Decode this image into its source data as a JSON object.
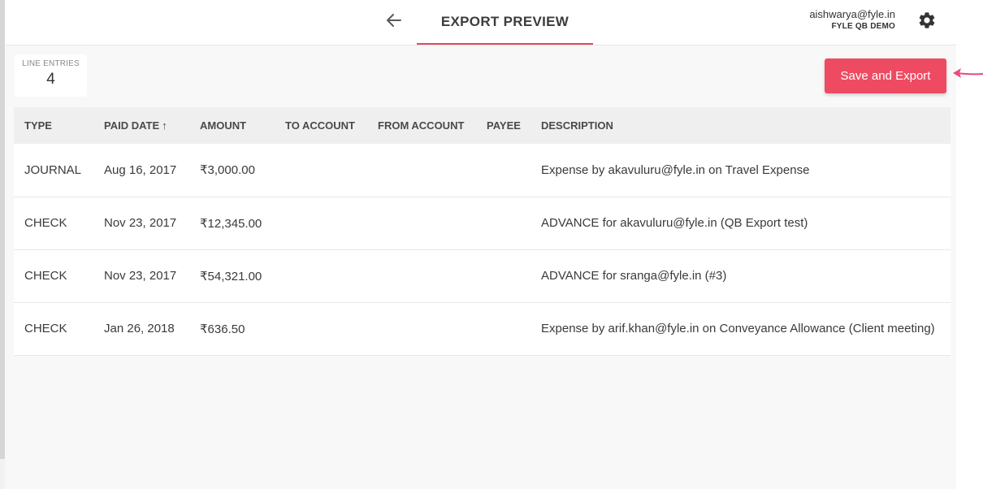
{
  "header": {
    "title": "EXPORT PREVIEW",
    "user_email": "aishwarya@fyle.in",
    "org_name": "FYLE QB DEMO"
  },
  "summary": {
    "label": "LINE ENTRIES",
    "count": "4"
  },
  "actions": {
    "save_export_label": "Save and Export"
  },
  "table": {
    "columns": {
      "type": "TYPE",
      "paid_date": "PAID DATE",
      "paid_date_sort": "↑",
      "amount": "AMOUNT",
      "to_account": "TO ACCOUNT",
      "from_account": "FROM ACCOUNT",
      "payee": "PAYEE",
      "description": "DESCRIPTION"
    },
    "rows": [
      {
        "type": "JOURNAL",
        "paid_date": "Aug 16, 2017",
        "amount": "₹3,000.00",
        "to_account": "",
        "from_account": "",
        "payee": "",
        "description": "Expense by akavuluru@fyle.in on Travel Expense"
      },
      {
        "type": "CHECK",
        "paid_date": "Nov 23, 2017",
        "amount": "₹12,345.00",
        "to_account": "",
        "from_account": "",
        "payee": "",
        "description": "ADVANCE for akavuluru@fyle.in (QB Export test)"
      },
      {
        "type": "CHECK",
        "paid_date": "Nov 23, 2017",
        "amount": "₹54,321.00",
        "to_account": "",
        "from_account": "",
        "payee": "",
        "description": "ADVANCE for sranga@fyle.in (#3)"
      },
      {
        "type": "CHECK",
        "paid_date": "Jan 26, 2018",
        "amount": "₹636.50",
        "to_account": "",
        "from_account": "",
        "payee": "",
        "description": "Expense by arif.khan@fyle.in on Conveyance Allowance (Client meeting)"
      }
    ]
  },
  "colors": {
    "accent": "#ee4b63",
    "title_underline": "#e8475b",
    "annotation_arrow": "#e84a7f"
  },
  "icons": {
    "back": "arrow-left-icon",
    "settings": "gear-icon",
    "annotation": "annotation-arrow-icon"
  }
}
